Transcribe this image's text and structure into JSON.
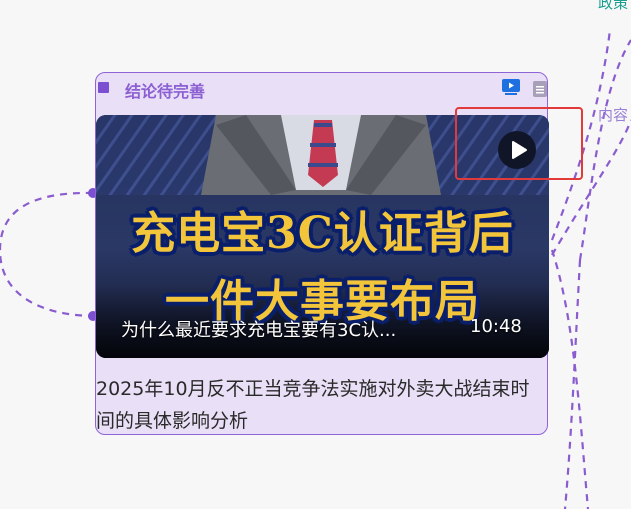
{
  "side_labels": {
    "top": "政策",
    "right": "内容"
  },
  "card": {
    "title": "结论待完善",
    "video": {
      "headline_line1": "充电宝3C认证背后",
      "headline_line2": "一件大事要布局",
      "caption": "为什么最近要求充电宝要有3C认...",
      "duration": "10:48"
    },
    "description": "2025年10月反不正当竞争法实施对外卖大战结束时间的具体影响分析"
  },
  "icons": {
    "header_marker": "square-marker-icon",
    "video_type": "video-icon",
    "doc_type": "document-icon",
    "play": "play-icon"
  },
  "colors": {
    "card_bg": "#e9e0f7",
    "card_border": "#8f64d6",
    "title": "#8c5fd3",
    "connector": "#8a5ccf",
    "highlight": "#e23a3a"
  }
}
